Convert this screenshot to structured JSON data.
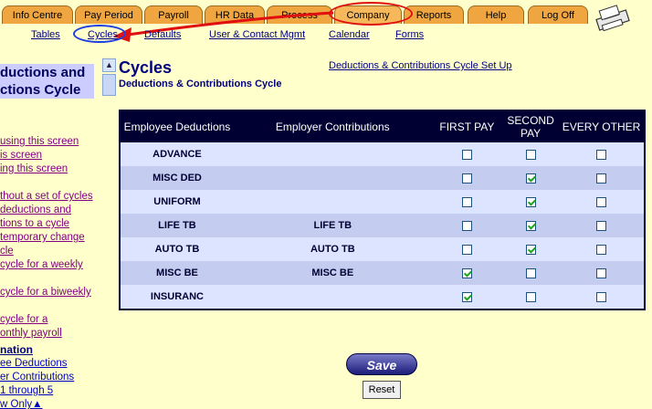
{
  "tabs": [
    {
      "label": "Info Centre"
    },
    {
      "label": "Pay Period"
    },
    {
      "label": "Payroll"
    },
    {
      "label": "HR Data"
    },
    {
      "label": "Process"
    },
    {
      "label": "Company"
    },
    {
      "label": "Reports"
    },
    {
      "label": "Help"
    },
    {
      "label": "Log Off"
    }
  ],
  "subnav": {
    "tables": "Tables",
    "cycles": "Cycles",
    "defaults": "Defaults",
    "user_contact": "User & Contact Mgmt",
    "calendar": "Calendar",
    "forms": "Forms"
  },
  "left_panel": {
    "title_line1": "ductions and",
    "title_line2": "ctions Cycle",
    "links": [
      "using this screen",
      "is screen",
      "ing this screen",
      "thout a set of cycles",
      "deductions and",
      "tions to a cycle",
      "temporary change",
      "cle",
      "cycle for a weekly",
      "cycle for a biweekly",
      "cycle for a",
      "onthly payroll"
    ],
    "heading": "nation",
    "sub_links": [
      "ee Deductions",
      "er Contributions",
      "1 through 5",
      "w Only▲"
    ]
  },
  "main": {
    "title": "Cycles",
    "subtitle": "Deductions & Contributions Cycle",
    "setup_link": "Deductions & Contributions Cycle Set Up"
  },
  "table": {
    "headers": {
      "employee_deductions": "Employee Deductions",
      "employer_contributions": "Employer Contributions",
      "first_pay": "FIRST PAY",
      "second_pay": "SECOND PAY",
      "every_other": "EVERY OTHER"
    },
    "rows": [
      {
        "deduction": "ADVANCE",
        "contribution": "",
        "first": false,
        "second": false,
        "other": false
      },
      {
        "deduction": "MISC DED",
        "contribution": "",
        "first": false,
        "second": true,
        "other": false
      },
      {
        "deduction": "UNIFORM",
        "contribution": "",
        "first": false,
        "second": true,
        "other": false
      },
      {
        "deduction": "LIFE TB",
        "contribution": "LIFE TB",
        "first": false,
        "second": true,
        "other": false
      },
      {
        "deduction": "AUTO TB",
        "contribution": "AUTO TB",
        "first": false,
        "second": true,
        "other": false
      },
      {
        "deduction": "MISC BE",
        "contribution": "MISC BE",
        "first": true,
        "second": false,
        "other": false
      },
      {
        "deduction": "INSURANC",
        "contribution": "",
        "first": true,
        "second": false,
        "other": false
      }
    ]
  },
  "buttons": {
    "save": "Save",
    "reset": "Reset"
  },
  "colors": {
    "tab": "#f0a640",
    "header": "#000033",
    "background": "#ffffcc",
    "annotation_red": "#e01010",
    "annotation_blue": "#2040e0"
  }
}
